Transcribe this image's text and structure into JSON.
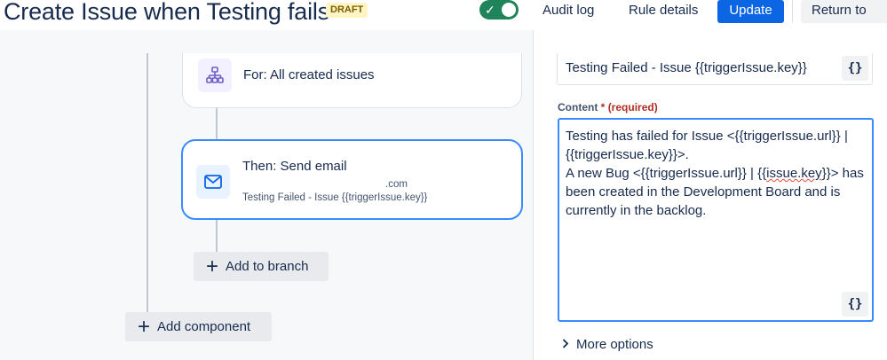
{
  "header": {
    "title": "Create Issue when Testing fails",
    "status_badge": "DRAFT",
    "toggle_check": "✓",
    "audit_log": "Audit log",
    "rule_details": "Rule details",
    "update": "Update",
    "return": "Return to"
  },
  "canvas": {
    "branch_card": {
      "label": "For: All created issues",
      "icon": "branch-icon"
    },
    "action_card": {
      "label": "Then: Send email",
      "recipient_suffix": ".com",
      "subject_preview": "Testing Failed - Issue {{triggerIssue.key}}",
      "icon": "envelope-icon"
    },
    "add_to_branch": "Add to branch",
    "add_component": "Add component"
  },
  "panel": {
    "subject_value": "Testing Failed - Issue {{triggerIssue.key}}",
    "smart_values_button": "{}",
    "content_label": "Content",
    "content_required_star": "*",
    "content_required_text": "(required)",
    "content_lines": [
      "Testing has failed for Issue <{{triggerIssue.url}} |",
      "{{triggerIssue.key}}>.",
      "A new Bug  <{{triggerIssue.url}} | {{",
      "issue.key",
      "}}> has",
      "been created in the Development Board and is",
      "currently in the backlog."
    ],
    "more_options": "More options"
  },
  "colors": {
    "primary": "#0c66e4",
    "toggle_on": "#1f845a",
    "focus_border": "#388bff",
    "draft_bg": "#fff4c4"
  }
}
